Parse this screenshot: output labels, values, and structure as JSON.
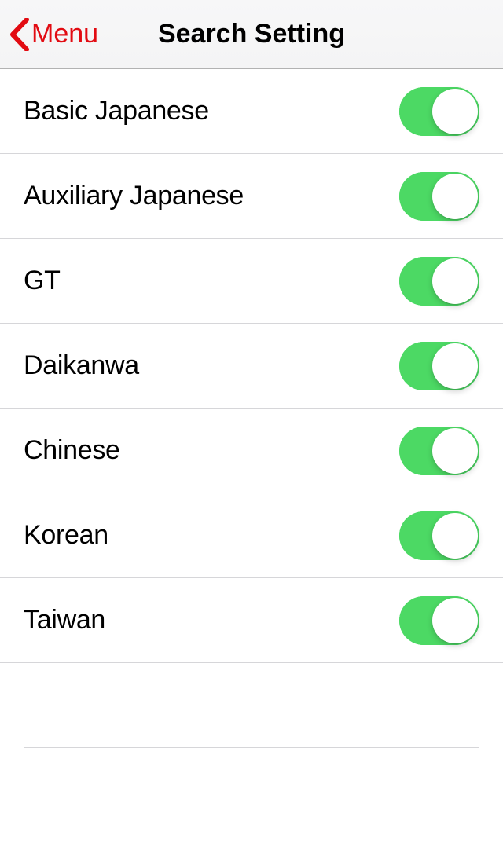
{
  "header": {
    "back_label": "Menu",
    "title": "Search Setting"
  },
  "colors": {
    "accent_red": "#e20b12",
    "switch_on": "#4cd964"
  },
  "settings": [
    {
      "label": "Basic Japanese",
      "on": true
    },
    {
      "label": "Auxiliary Japanese",
      "on": true
    },
    {
      "label": "GT",
      "on": true
    },
    {
      "label": "Daikanwa",
      "on": true
    },
    {
      "label": "Chinese",
      "on": true
    },
    {
      "label": "Korean",
      "on": true
    },
    {
      "label": "Taiwan",
      "on": true
    }
  ]
}
